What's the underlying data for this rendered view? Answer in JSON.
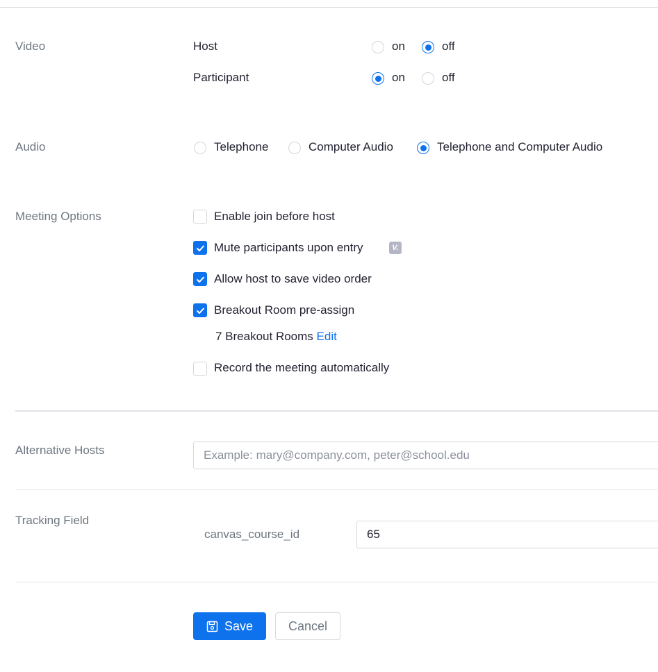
{
  "video": {
    "label": "Video",
    "host": {
      "label": "Host",
      "on_label": "on",
      "off_label": "off",
      "selected": "off"
    },
    "participant": {
      "label": "Participant",
      "on_label": "on",
      "off_label": "off",
      "selected": "on"
    }
  },
  "audio": {
    "label": "Audio",
    "options": [
      {
        "label": "Telephone",
        "selected": false
      },
      {
        "label": "Computer Audio",
        "selected": false
      },
      {
        "label": "Telephone and Computer Audio",
        "selected": true
      }
    ]
  },
  "meeting_options": {
    "label": "Meeting Options",
    "items": [
      {
        "label": "Enable join before host",
        "checked": false
      },
      {
        "label": "Mute participants upon entry",
        "checked": true,
        "badge": "V."
      },
      {
        "label": "Allow host to save video order",
        "checked": true
      },
      {
        "label": "Breakout Room pre-assign",
        "checked": true
      },
      {
        "label": "Record the meeting automatically",
        "checked": false
      }
    ],
    "breakout_rooms": {
      "text": "7 Breakout Rooms",
      "edit_label": "Edit"
    }
  },
  "alternative_hosts": {
    "label": "Alternative Hosts",
    "placeholder": "Example: mary@company.com, peter@school.edu",
    "value": ""
  },
  "tracking_field": {
    "label": "Tracking Field",
    "field_name": "canvas_course_id",
    "value": "65"
  },
  "actions": {
    "save_label": "Save",
    "cancel_label": "Cancel",
    "accent_color": "#0e72ed"
  }
}
